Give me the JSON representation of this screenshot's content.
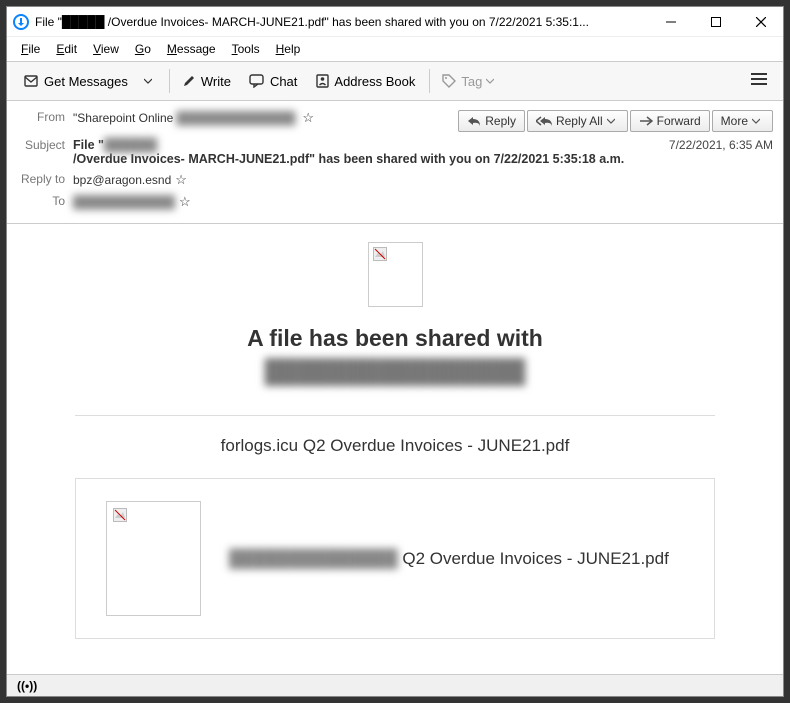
{
  "titlebar": {
    "title": "File \"█████ /Overdue Invoices- MARCH-JUNE21.pdf\" has been shared with you on 7/22/2021 5:35:1..."
  },
  "menubar": {
    "file": "File",
    "edit": "Edit",
    "view": "View",
    "go": "Go",
    "message": "Message",
    "tools": "Tools",
    "help": "Help"
  },
  "toolbar": {
    "get_messages": "Get Messages",
    "write": "Write",
    "chat": "Chat",
    "address_book": "Address Book",
    "tag": "Tag"
  },
  "headers": {
    "from_label": "From",
    "from_value": "\"Sharepoint Online",
    "from_blur": "██████████████",
    "subject_label": "Subject",
    "subject_pre": "File \"",
    "subject_blur": "██████",
    "subject_rest": " /Overdue Invoices- MARCH-JUNE21.pdf\" has been shared with you on 7/22/2021 5:35:18 a.m.",
    "date": "7/22/2021, 6:35 AM",
    "reply_to_label": "Reply to",
    "reply_to_value": "bpz@aragon.esnd",
    "to_label": "To",
    "to_blur": "████████████"
  },
  "actions": {
    "reply": "Reply",
    "reply_all": "Reply All",
    "forward": "Forward",
    "more": "More"
  },
  "email": {
    "heading": "A file has been shared with",
    "heading_blur": "████████████████",
    "sub_heading": "forlogs.icu Q2 Overdue Invoices - JUNE21.pdf",
    "file_blur": "██████████████",
    "file_rest": " Q2 Overdue Invoices - JUNE21.pdf"
  },
  "statusbar": {
    "icon": "((•))"
  }
}
